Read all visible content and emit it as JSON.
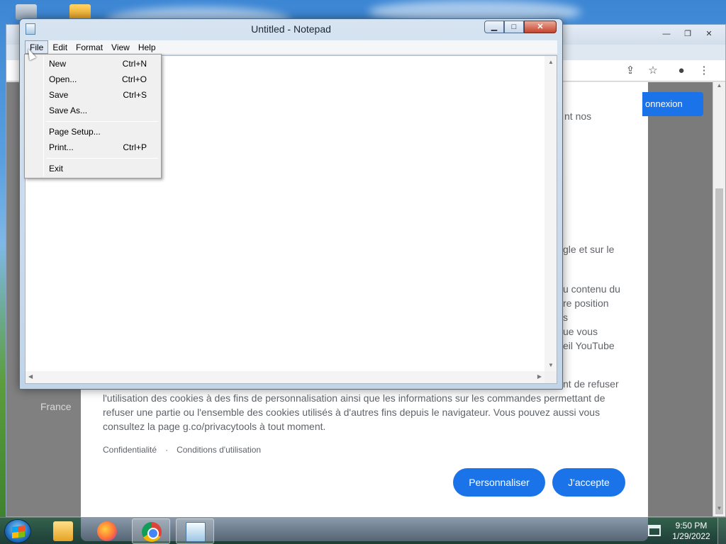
{
  "notepad": {
    "title": "Untitled - Notepad",
    "menu": [
      "File",
      "Edit",
      "Format",
      "View",
      "Help"
    ],
    "file_menu": [
      {
        "label": "New",
        "shortcut": "Ctrl+N"
      },
      {
        "label": "Open...",
        "shortcut": "Ctrl+O"
      },
      {
        "label": "Save",
        "shortcut": "Ctrl+S"
      },
      {
        "label": "Save As...",
        "shortcut": ""
      },
      {
        "label": "Page Setup...",
        "shortcut": ""
      },
      {
        "label": "Print...",
        "shortcut": "Ctrl+P"
      },
      {
        "label": "Exit",
        "shortcut": ""
      }
    ]
  },
  "browser": {
    "signin_button": "onnexion",
    "side_label": "France",
    "fragments": {
      "f1": "nt nos",
      "f2": "gle et sur le",
      "f3": "u contenu du",
      "f4": "re position",
      "f5": "s",
      "f6": "ue vous",
      "f7": "eil YouTube",
      "f8": "nt de refuser"
    },
    "consent_lines": [
      "l'utilisation des cookies à des fins de personnalisation ainsi que les informations sur les commandes permettant de",
      "refuser une partie ou l'ensemble des cookies utilisés à d'autres fins depuis le navigateur. Vous pouvez aussi vous",
      "consultez la page g.co/privacytools à tout moment."
    ],
    "footer": {
      "privacy": "Confidentialité",
      "dot": "·",
      "terms": "Conditions d'utilisation"
    },
    "buttons": {
      "customize": "Personnaliser",
      "accept": "J'accepte"
    }
  },
  "taskbar": {
    "time": "9:50 PM",
    "date": "1/29/2022"
  },
  "colors": {
    "accent": "#1a73e8",
    "close_button": "#c7432c"
  }
}
